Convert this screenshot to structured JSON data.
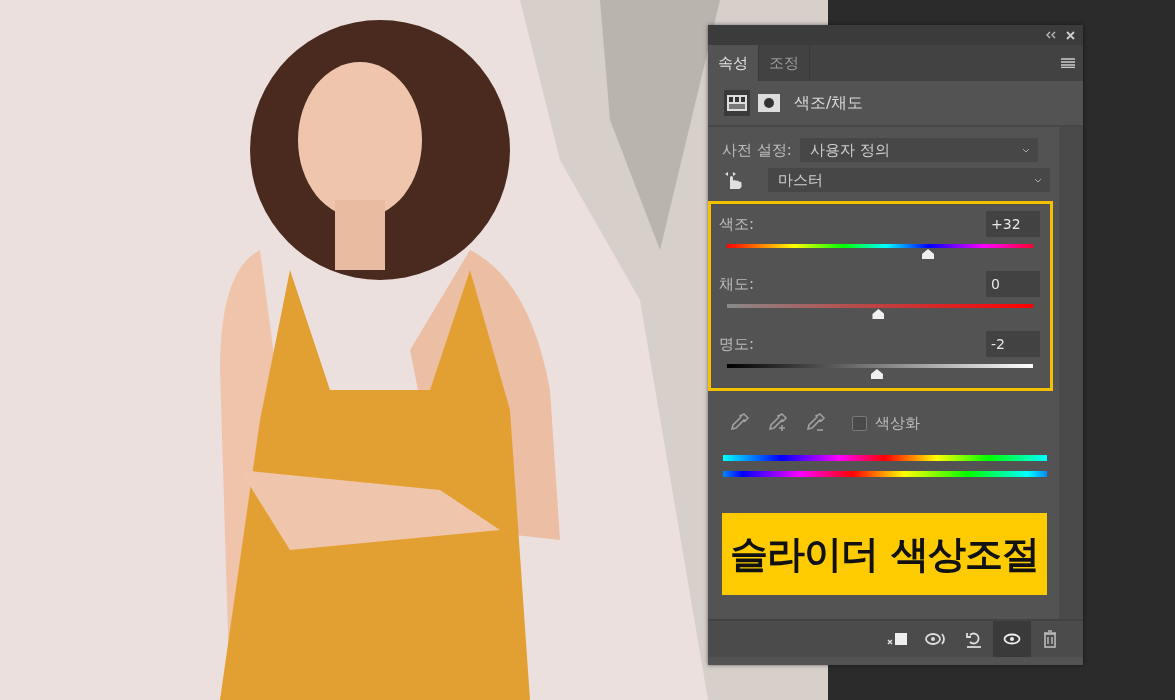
{
  "panel": {
    "tabs": [
      {
        "label": "속성",
        "selected": true
      },
      {
        "label": "조정",
        "selected": false
      }
    ],
    "title": "색조/채도",
    "preset": {
      "label": "사전 설정:",
      "value": "사용자 정의"
    },
    "channel": {
      "value": "마스터"
    },
    "sliders": [
      {
        "kind": "hue",
        "label": "색조:",
        "value": "+32",
        "level": 0.657
      },
      {
        "kind": "saturation",
        "label": "채도:",
        "value": "0",
        "level": 0.495
      },
      {
        "kind": "lightness",
        "label": "명도:",
        "value": "-2",
        "level": 0.49
      }
    ],
    "colorize": {
      "label": "색상화",
      "checked": false
    },
    "banner": "슬라이더 색상조절",
    "footer": {
      "visibility_pressed": true
    }
  }
}
